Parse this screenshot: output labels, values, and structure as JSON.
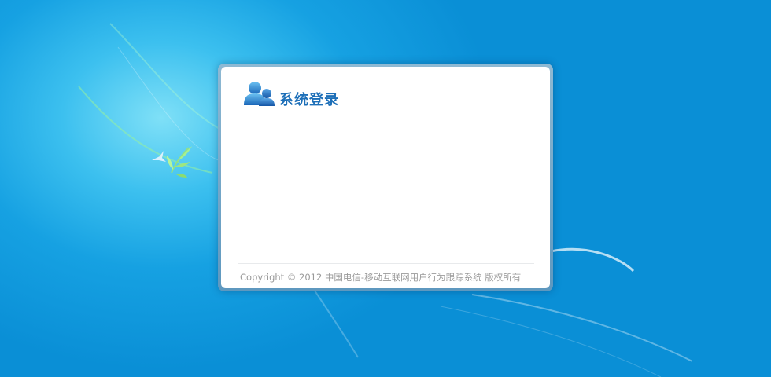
{
  "login": {
    "title": "系统登录",
    "user_icon": "user-group-icon",
    "copyright": "Copyright © 2012  中国电信-移动互联网用户行为跟踪系统  版权所有"
  },
  "background": {
    "decoration_icon": "leaf-sprout-icon",
    "bird_icon": "bird-icon"
  },
  "colors": {
    "background_blue": "#0a8fd6",
    "title_blue": "#1d6fb8",
    "panel_border": "#6fa6c9"
  }
}
